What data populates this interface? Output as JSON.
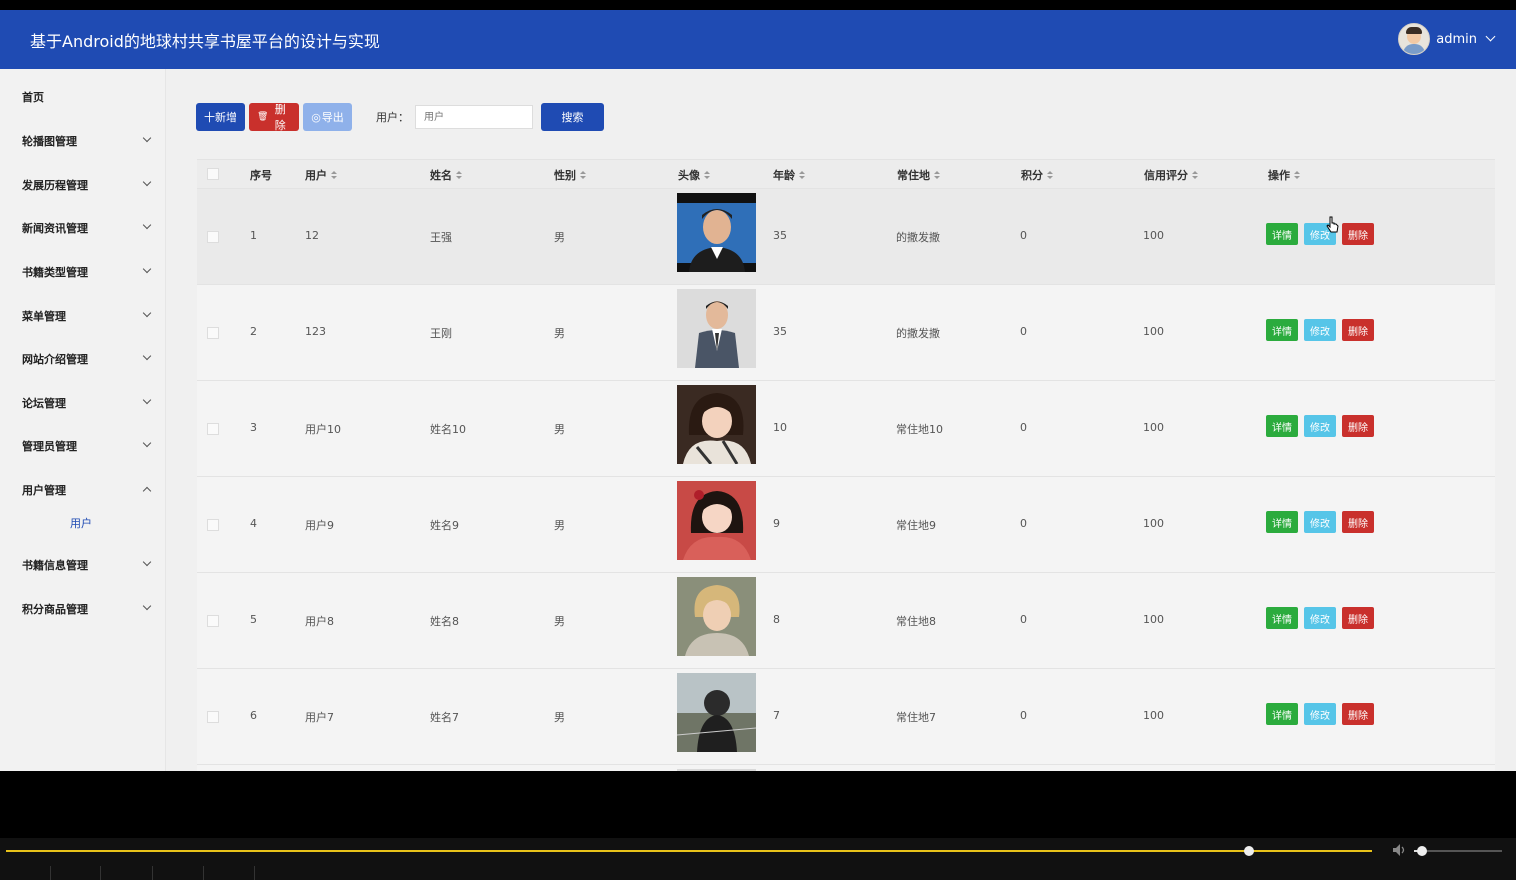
{
  "header": {
    "title": "基于Android的地球村共享书屋平台的设计与实现",
    "username": "admin"
  },
  "sidebar": {
    "items": [
      {
        "label": "首页",
        "arrow": ""
      },
      {
        "label": "轮播图管理",
        "arrow": "down"
      },
      {
        "label": "发展历程管理",
        "arrow": "down"
      },
      {
        "label": "新闻资讯管理",
        "arrow": "down"
      },
      {
        "label": "书籍类型管理",
        "arrow": "down"
      },
      {
        "label": "菜单管理",
        "arrow": "down"
      },
      {
        "label": "网站介绍管理",
        "arrow": "down"
      },
      {
        "label": "论坛管理",
        "arrow": "down"
      },
      {
        "label": "管理员管理",
        "arrow": "down"
      },
      {
        "label": "用户管理",
        "arrow": "up"
      },
      {
        "label": "书籍信息管理",
        "arrow": "down"
      },
      {
        "label": "积分商品管理",
        "arrow": "down"
      }
    ],
    "sub_item": "用户"
  },
  "toolbar": {
    "add_label": "十新增",
    "delete_label": "删除",
    "export_label": "导出",
    "search_label": "用户：",
    "search_placeholder": "用户",
    "search_button": "搜索"
  },
  "table": {
    "headers": [
      "序号",
      "用户",
      "姓名",
      "性别",
      "头像",
      "年龄",
      "常住地",
      "积分",
      "信用评分",
      "操作"
    ],
    "rows": [
      {
        "no": "1",
        "user": "12",
        "name": "王强",
        "gender": "男",
        "age": "35",
        "address": "的撒发撒",
        "points": "0",
        "credit": "100"
      },
      {
        "no": "2",
        "user": "123",
        "name": "王刚",
        "gender": "男",
        "age": "35",
        "address": "的撒发撒",
        "points": "0",
        "credit": "100"
      },
      {
        "no": "3",
        "user": "用户10",
        "name": "姓名10",
        "gender": "男",
        "age": "10",
        "address": "常住地10",
        "points": "0",
        "credit": "100"
      },
      {
        "no": "4",
        "user": "用户9",
        "name": "姓名9",
        "gender": "男",
        "age": "9",
        "address": "常住地9",
        "points": "0",
        "credit": "100"
      },
      {
        "no": "5",
        "user": "用户8",
        "name": "姓名8",
        "gender": "男",
        "age": "8",
        "address": "常住地8",
        "points": "0",
        "credit": "100"
      },
      {
        "no": "6",
        "user": "用户7",
        "name": "姓名7",
        "gender": "男",
        "age": "7",
        "address": "常住地7",
        "points": "0",
        "credit": "100"
      }
    ],
    "actions": {
      "detail": "详情",
      "edit": "修改",
      "delete": "删除"
    }
  },
  "player": {
    "progress": 0.91,
    "volume": 0.09
  },
  "colors": {
    "header": "#1f4bb3",
    "detail": "#2bab3d",
    "edit": "#56c5e8",
    "delete": "#c9302c"
  }
}
